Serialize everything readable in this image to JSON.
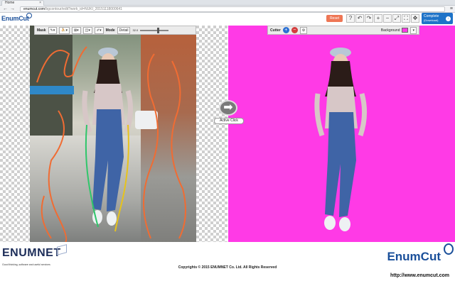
{
  "browser": {
    "tab_title": "Home",
    "tab_close": "×",
    "url_host": "enumcut.com",
    "url_path": "/bgcontour/edit?work_id=NUKI_20151118000641",
    "menu_icon": "≡",
    "back_icon": "←",
    "forward_icon": "→"
  },
  "app": {
    "logo": "EnumCut",
    "reset_label": "Reset",
    "toolbar_icons": [
      "help-icon",
      "undo-icon",
      "redo-icon",
      "zoom-in-icon",
      "zoom-out-icon",
      "fit-icon",
      "fullscreen-icon",
      "move-icon"
    ],
    "toolbar_glyphs": [
      "?",
      "↶",
      "↷",
      "+",
      "−",
      "⤢",
      "⛶",
      "✥"
    ],
    "complete_label": "Complete",
    "complete_sub": "(Download)",
    "download_glyph": "↓"
  },
  "left_toolbar": {
    "mask_label": "Mask",
    "mode_label": "Mode",
    "mode_value": "Detail",
    "brush_value": "32.0",
    "brush_level": 0.6
  },
  "right_toolbar": {
    "cutter_label": "Cutter",
    "background_label": "Background",
    "background_color": "#ff3ae6",
    "add_glyph": "+",
    "remove_glyph": "−"
  },
  "canvas": {
    "active_click_label": "Active Click",
    "arrow_glyph": "➡",
    "right_bg": "#ff3ae6"
  },
  "footer": {
    "enumnet_logo": "ENUMNET",
    "enumnet_tagline": "Good thinking, software and useful services",
    "copyright": "Copyrights © 2015 ENUMNET Co. Ltd. All Rights Reserved",
    "enumcut_logo": "EnumCut",
    "website": "http://www.enumcut.com"
  }
}
